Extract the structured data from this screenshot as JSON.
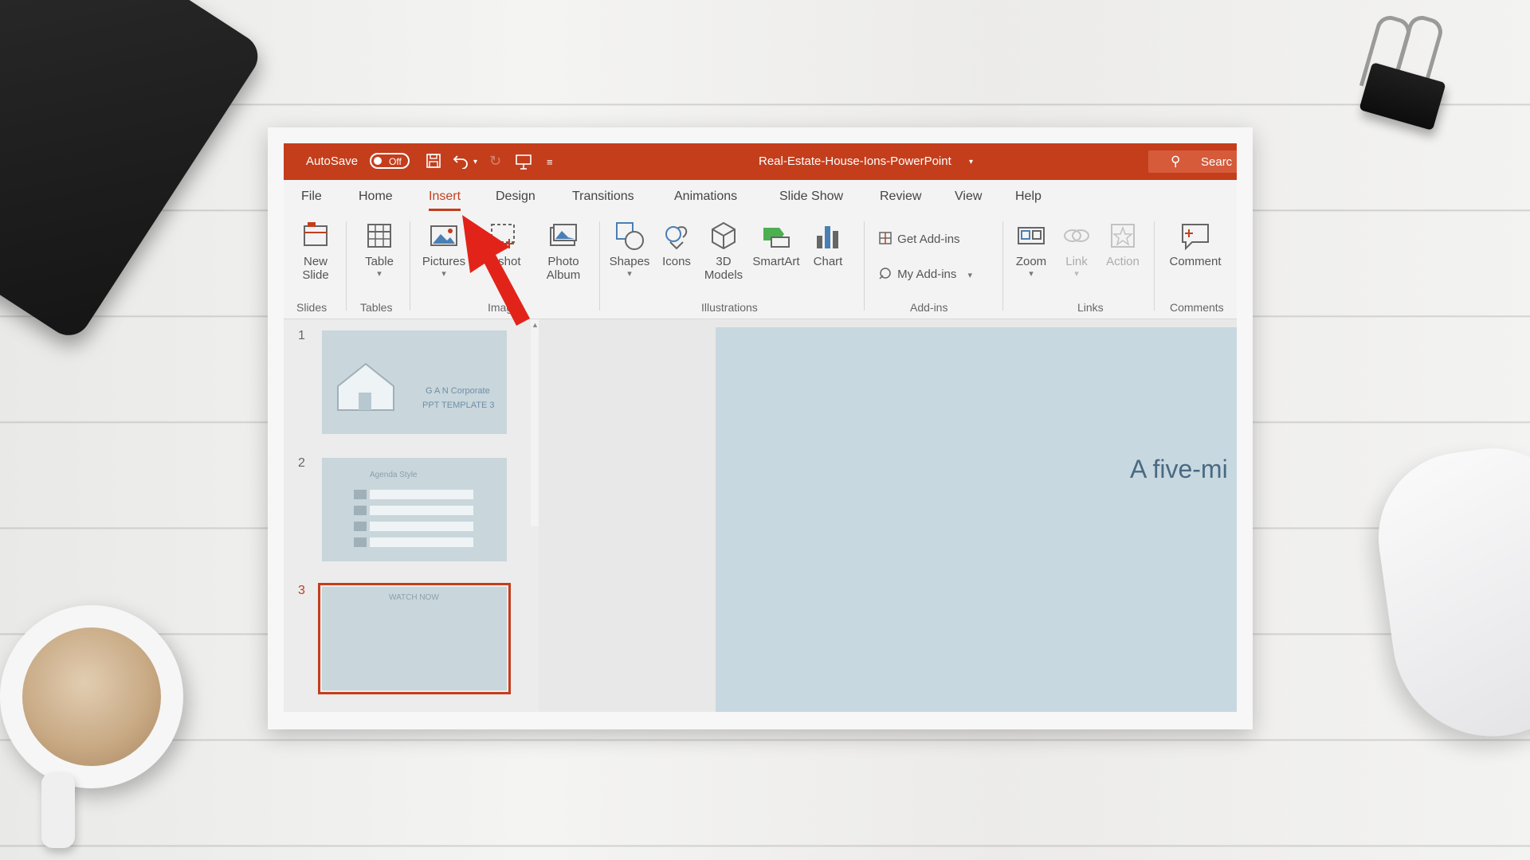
{
  "window": {
    "autosave_label": "AutoSave",
    "autosave_state": "Off",
    "doc_title": "Real-Estate-House-Ions-PowerPoint",
    "search_label": "Searc"
  },
  "tabs": [
    "File",
    "Home",
    "Insert",
    "Design",
    "Transitions",
    "Animations",
    "Slide Show",
    "Review",
    "View",
    "Help"
  ],
  "active_tab": "Insert",
  "ribbon": {
    "new_slide": "New Slide",
    "table": "Table",
    "pictures": "Pictures",
    "screenshot": "enshot",
    "photo_album": "Photo Album",
    "shapes": "Shapes",
    "icons": "Icons",
    "models_3d": "3D Models",
    "smartart": "SmartArt",
    "chart": "Chart",
    "get_addins": "Get Add-ins",
    "my_addins": "My Add-ins",
    "zoom": "Zoom",
    "link": "Link",
    "action": "Action",
    "comment": "Comment",
    "groups": {
      "slides": "Slides",
      "tables": "Tables",
      "images": "Imag",
      "illustrations": "Illustrations",
      "addins": "Add-ins",
      "links": "Links",
      "comments": "Comments"
    }
  },
  "slides": [
    {
      "num": "1",
      "line1": "G A N Corporate",
      "line2": "PPT TEMPLATE 3"
    },
    {
      "num": "2",
      "title": "Agenda Style"
    },
    {
      "num": "3",
      "title": "WATCH NOW"
    }
  ],
  "canvas_text": "A five-mi",
  "colors": {
    "accent": "#c43e1c",
    "canvas": "#c8d8e0"
  }
}
